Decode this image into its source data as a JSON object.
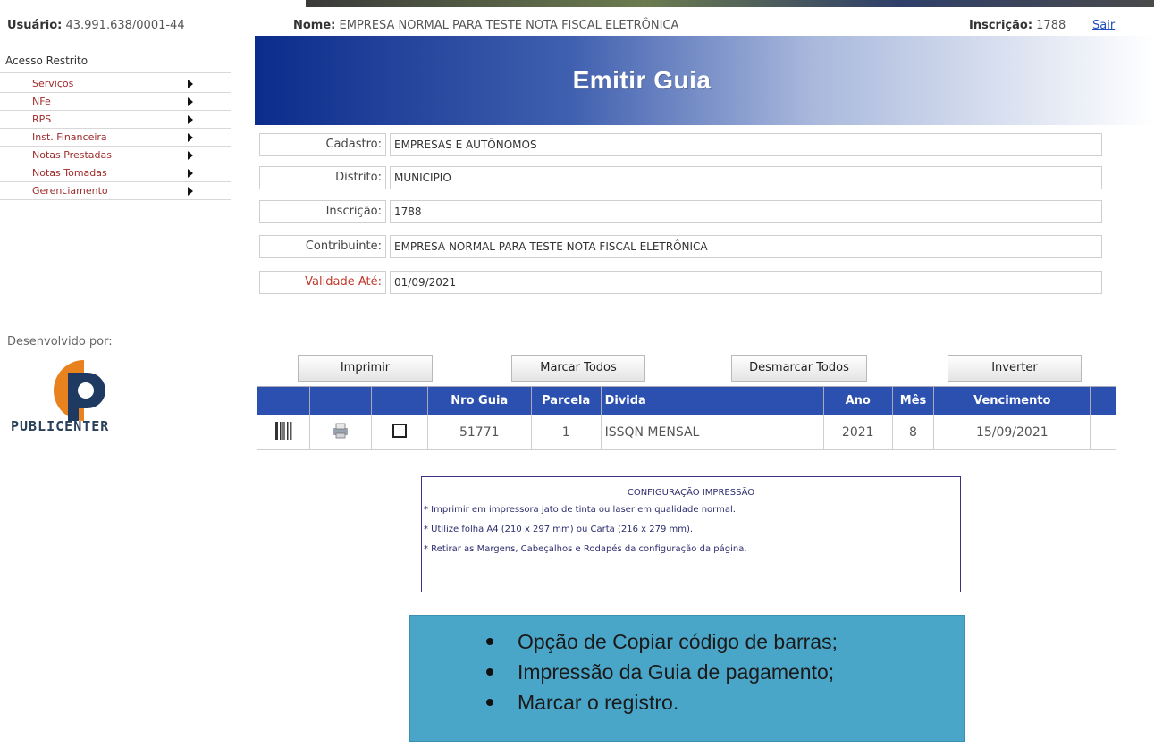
{
  "header": {
    "user_label": "Usuário:",
    "user_value": "43.991.638/0001-44",
    "name_label": "Nome:",
    "name_value": "EMPRESA NORMAL PARA TESTE NOTA FISCAL ELETRÔNICA",
    "inscricao_label": "Inscrição:",
    "inscricao_value": "1788",
    "logout": "Sair"
  },
  "sidebar": {
    "title": "Acesso Restrito",
    "items": [
      {
        "label": "Serviços"
      },
      {
        "label": "NFe"
      },
      {
        "label": "RPS"
      },
      {
        "label": "Inst. Financeira"
      },
      {
        "label": "Notas Prestadas"
      },
      {
        "label": "Notas Tomadas"
      },
      {
        "label": "Gerenciamento"
      }
    ],
    "developed_by": "Desenvolvido por:",
    "brand": "PUBLICENTER"
  },
  "banner": {
    "title": "Emitir Guia"
  },
  "form": {
    "cadastro_label": "Cadastro:",
    "cadastro_value": "EMPRESAS E AUTÔNOMOS",
    "distrito_label": "Distrito:",
    "distrito_value": "MUNICIPIO",
    "inscricao_label": "Inscrição:",
    "inscricao_value": "1788",
    "contribuinte_label": "Contribuinte:",
    "contribuinte_value": "EMPRESA NORMAL PARA TESTE NOTA FISCAL ELETRÔNICA",
    "validade_label": "Validade Até:",
    "validade_value": "01/09/2021"
  },
  "buttons": {
    "print": "Imprimir",
    "select_all": "Marcar Todos",
    "deselect_all": "Desmarcar Todos",
    "invert": "Inverter"
  },
  "table": {
    "headers": [
      "Nro Guia",
      "Parcela",
      "Divida",
      "Ano",
      "Mês",
      "Vencimento"
    ],
    "rows": [
      {
        "nro_guia": "51771",
        "parcela": "1",
        "divida": "ISSQN MENSAL",
        "ano": "2021",
        "mes": "8",
        "vencimento": "15/09/2021"
      }
    ]
  },
  "print_config": {
    "title": "CONFIGURAÇÃO IMPRESSÃO",
    "lines": [
      "* Imprimir em impressora jato de tinta ou laser em qualidade normal.",
      "* Utilize folha A4 (210 x 297 mm) ou Carta (216 x 279 mm).",
      "* Retirar as Margens, Cabeçalhos e Rodapés da configuração da página."
    ]
  },
  "annotation": {
    "items": [
      "Opção de Copiar código de barras;",
      "Impressão da Guia de pagamento;",
      "Marcar o registro."
    ]
  },
  "colors": {
    "banner_dark": "#0c2c8c",
    "table_header": "#2b50b0",
    "menu_text": "#9e2b2b",
    "annotation_bg": "#4aa6c8"
  }
}
